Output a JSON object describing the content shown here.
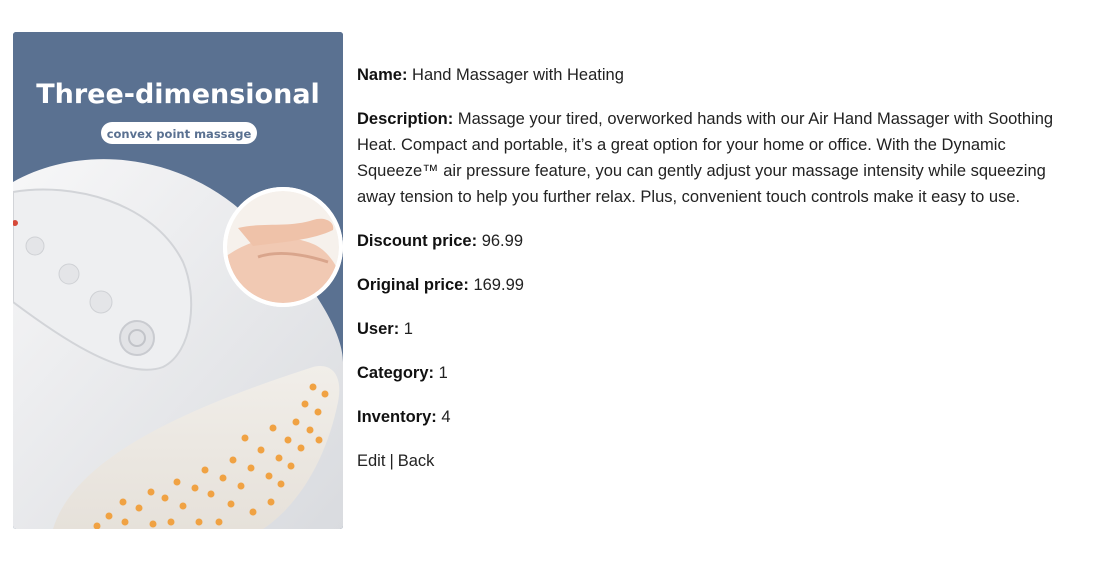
{
  "product": {
    "image": {
      "headline": "Three-dimensional",
      "subheadline": "convex point massage",
      "accent": "#5a7191",
      "dot_color": "#f0a243"
    },
    "fields": [
      {
        "label": "Name:",
        "value": "Hand Massager with Heating"
      },
      {
        "label": "Description:",
        "value": "Massage your tired, overworked hands with our Air Hand Massager with Soothing Heat. Compact and portable, it’s a great option for your home or office. With the Dynamic Squeeze™ air pressure feature, you can gently adjust your massage intensity while squeezing away tension to help you further relax. Plus, convenient touch controls make it easy to use."
      },
      {
        "label": "Discount price:",
        "value": "96.99"
      },
      {
        "label": "Original price:",
        "value": "169.99"
      },
      {
        "label": "User:",
        "value": "1"
      },
      {
        "label": "Category:",
        "value": "1"
      },
      {
        "label": "Inventory:",
        "value": "4"
      }
    ],
    "links": {
      "edit": "Edit",
      "separator": "|",
      "back": "Back"
    }
  }
}
